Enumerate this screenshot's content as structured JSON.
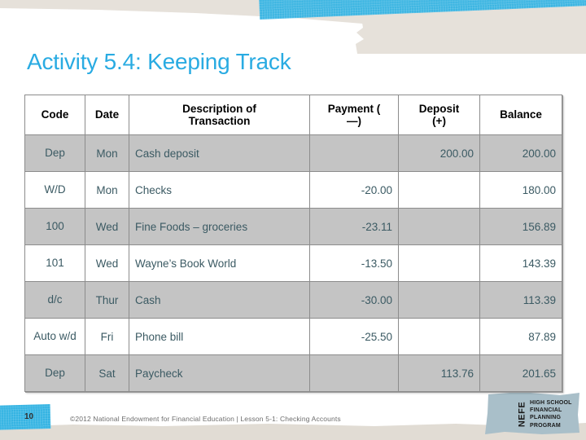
{
  "slide": {
    "title": "Activity 5.4: Keeping Track",
    "page_number": "10",
    "footer_credit": "©2012 National Endowment for Financial Education | Lesson 5-1: Checking Accounts",
    "title_color": "#29ABE2",
    "tape_color": "#35B4E3",
    "header_text_color": "#000000",
    "cell_text_color": "#3B5A63",
    "row_shade_color": "#C4C4C4"
  },
  "logo": {
    "mark": "NEFE",
    "line1": "HIGH SCHOOL",
    "line2": "FINANCIAL",
    "line3": "PLANNING",
    "line4": "PROGRAM"
  },
  "table": {
    "columns": [
      {
        "key": "code",
        "label": "Code"
      },
      {
        "key": "date",
        "label": "Date"
      },
      {
        "key": "description",
        "label_line1": "Description of",
        "label_line2": "Transaction"
      },
      {
        "key": "payment",
        "label_line1": "Payment (",
        "label_line2": "—)"
      },
      {
        "key": "deposit",
        "label_line1": "Deposit",
        "label_line2": "(+)"
      },
      {
        "key": "balance",
        "label": "Balance"
      }
    ],
    "rows": [
      {
        "code": "Dep",
        "date": "Mon",
        "description": "Cash deposit",
        "payment": "",
        "deposit": "200.00",
        "balance": "200.00",
        "shaded": true
      },
      {
        "code": "W/D",
        "date": "Mon",
        "description": "Checks",
        "payment": "-20.00",
        "deposit": "",
        "balance": "180.00",
        "shaded": false
      },
      {
        "code": "100",
        "date": "Wed",
        "description": "Fine Foods – groceries",
        "payment": "-23.11",
        "deposit": "",
        "balance": "156.89",
        "shaded": true
      },
      {
        "code": "101",
        "date": "Wed",
        "description": "Wayne’s Book World",
        "payment": "-13.50",
        "deposit": "",
        "balance": "143.39",
        "shaded": false
      },
      {
        "code": "d/c",
        "date": "Thur",
        "description": "Cash",
        "payment": "-30.00",
        "deposit": "",
        "balance": "113.39",
        "shaded": true
      },
      {
        "code": "Auto w/d",
        "date": "Fri",
        "description": "Phone bill",
        "payment": "-25.50",
        "deposit": "",
        "balance": "87.89",
        "shaded": false
      },
      {
        "code": "Dep",
        "date": "Sat",
        "description": "Paycheck",
        "payment": "",
        "deposit": "113.76",
        "balance": "201.65",
        "shaded": true
      }
    ]
  }
}
